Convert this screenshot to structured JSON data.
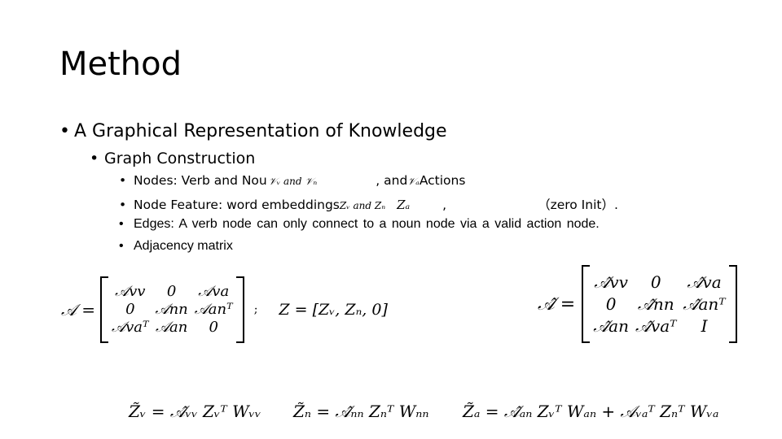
{
  "slide": {
    "title": "Method",
    "level1": "A Graphical Representation of Knowledge",
    "level2": "Graph Construction",
    "bullets": [
      {
        "prefix": "Nodes:  Verb  and  Nou",
        "math1": "𝒱ᵥ and 𝒱ₙ",
        "mid": ",  and",
        "math2": "𝒱ₐ",
        "suffix": "Actions"
      },
      {
        "prefix": "Node  Feature:  word embeddings",
        "math1": "Zᵥ and Zₙ",
        "math2": "Zₐ",
        "mid": ",",
        "suffix": "（zero  Init）."
      },
      {
        "text": "Edges:  A  verb  node  can  only  connect  to  a  noun  node  via  a  valid  action  node."
      },
      {
        "text": "Adjacency matrix"
      }
    ],
    "equations": {
      "A_lhs": "𝒜 =",
      "A_matrix": [
        [
          "𝒜vv",
          "0",
          "𝒜va"
        ],
        [
          "0",
          "𝒜nn",
          "𝒜anᵀ"
        ],
        [
          "𝒜vaᵀ",
          "𝒜an",
          "0"
        ]
      ],
      "separator": ";",
      "Z_def": "Z = [Zᵥ, Zₙ, 0]",
      "Ahat_lhs": "𝒜̂ =",
      "Ahat_matrix": [
        [
          "𝒜̂vv",
          "0",
          "𝒜̂va"
        ],
        [
          "0",
          "𝒜̂nn",
          "𝒜̂anᵀ"
        ],
        [
          "𝒜̂an",
          "𝒜̂vaᵀ",
          "I"
        ]
      ],
      "update_v": "Z̃ᵥ = 𝒜̂ᵥᵥ Zᵥᵀ Wᵥᵥ",
      "update_n": "Z̃ₙ = 𝒜̂ₙₙ Zₙᵀ Wₙₙ",
      "update_a": "Z̃ₐ = 𝒜̂ₐₙ Zᵥᵀ Wₐₙ + 𝒜ᵥₐᵀ Zₙᵀ Wᵥₐ"
    }
  }
}
